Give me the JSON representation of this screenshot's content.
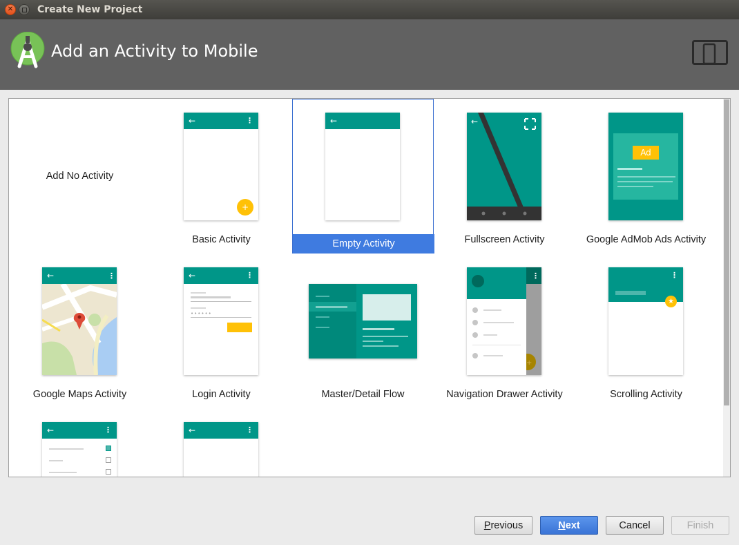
{
  "window": {
    "title": "Create New Project"
  },
  "header": {
    "title": "Add an Activity to Mobile"
  },
  "tiles": [
    {
      "label": "Add No Activity"
    },
    {
      "label": "Basic Activity"
    },
    {
      "label": "Empty Activity",
      "selected": true
    },
    {
      "label": "Fullscreen Activity"
    },
    {
      "label": "Google AdMob Ads Activity",
      "badge": "Ad"
    },
    {
      "label": "Google Maps Activity"
    },
    {
      "label": "Login Activity"
    },
    {
      "label": "Master/Detail Flow"
    },
    {
      "label": "Navigation Drawer Activity"
    },
    {
      "label": "Scrolling Activity"
    },
    {
      "label": ""
    },
    {
      "label": ""
    }
  ],
  "buttons": {
    "previous_mnemonic": "P",
    "previous_rest": "revious",
    "next_mnemonic": "N",
    "next_rest": "ext",
    "cancel": "Cancel",
    "finish": "Finish"
  },
  "colors": {
    "accent": "#009688",
    "fab": "#FFC107",
    "header": "#616161",
    "selection": "#3F7BE0"
  }
}
